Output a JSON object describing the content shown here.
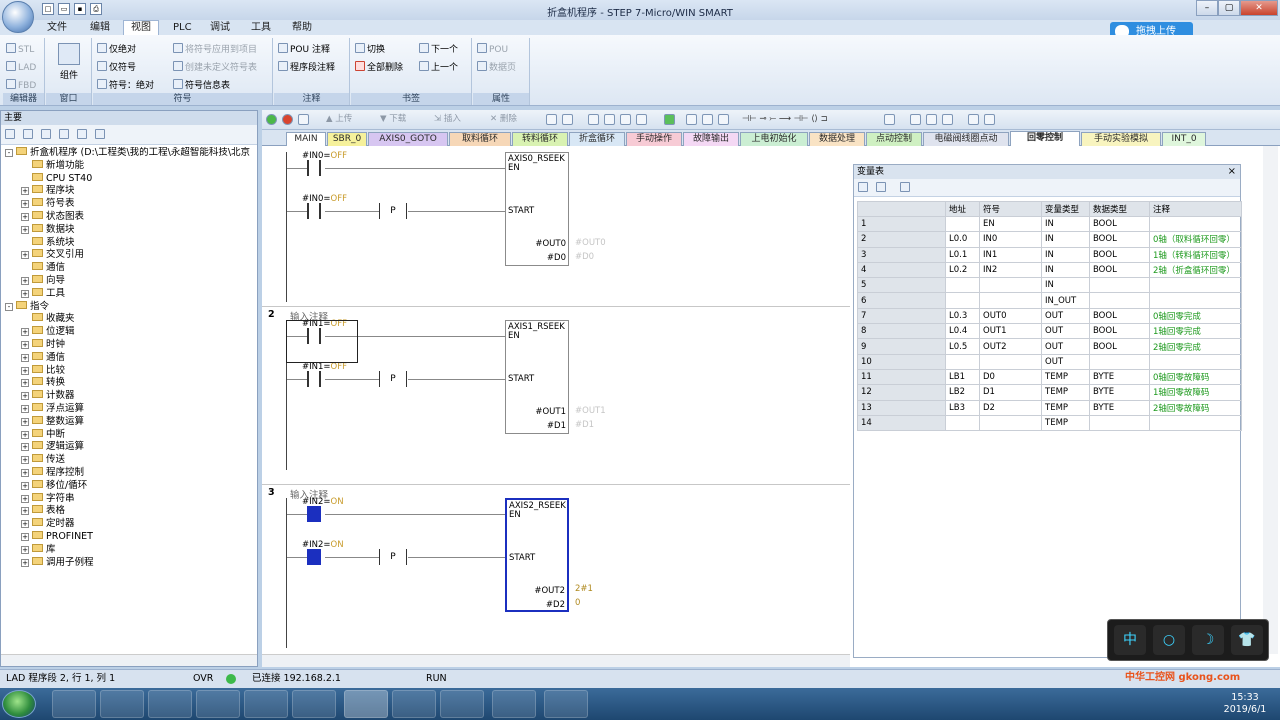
{
  "window": {
    "title": "折盒机程序 - STEP 7-Micro/WIN SMART"
  },
  "menu": [
    "文件",
    "编辑",
    "视图",
    "PLC",
    "调试",
    "工具",
    "帮助"
  ],
  "menu_active": "视图",
  "ribbon": {
    "groups": [
      {
        "label": "编辑器",
        "items": [
          "STL",
          "LAD",
          "FBD"
        ]
      },
      {
        "label": "窗口",
        "items": [
          "组件"
        ]
      },
      {
        "label": "符号",
        "items": [
          "仅绝对",
          "仅符号",
          "符号：绝对",
          "将符号应用到项目",
          "创建未定义符号表",
          "符号信息表"
        ]
      },
      {
        "label": "注释",
        "items": [
          "POU 注释",
          "程序段注释"
        ]
      },
      {
        "label": "书签",
        "items": [
          "切换",
          "全部删除",
          "下一个",
          "上一个"
        ]
      },
      {
        "label": "属性",
        "items": [
          "POU",
          "数据页"
        ]
      }
    ]
  },
  "upload_button": "拖拽上传",
  "left_panel": {
    "title": "主要",
    "tree": [
      {
        "label": "折盒机程序 (D:\\工程类\\我的工程\\永超智能科技\\北京",
        "level": 0,
        "exp": "-"
      },
      {
        "label": "新增功能",
        "level": 1,
        "exp": ""
      },
      {
        "label": "CPU ST40",
        "level": 1,
        "exp": ""
      },
      {
        "label": "程序块",
        "level": 1,
        "exp": "+"
      },
      {
        "label": "符号表",
        "level": 1,
        "exp": "+"
      },
      {
        "label": "状态图表",
        "level": 1,
        "exp": "+"
      },
      {
        "label": "数据块",
        "level": 1,
        "exp": "+"
      },
      {
        "label": "系统块",
        "level": 1,
        "exp": ""
      },
      {
        "label": "交叉引用",
        "level": 1,
        "exp": "+"
      },
      {
        "label": "通信",
        "level": 1,
        "exp": ""
      },
      {
        "label": "向导",
        "level": 1,
        "exp": "+"
      },
      {
        "label": "工具",
        "level": 1,
        "exp": "+"
      },
      {
        "label": "指令",
        "level": 0,
        "exp": "-"
      },
      {
        "label": "收藏夹",
        "level": 1,
        "exp": ""
      },
      {
        "label": "位逻辑",
        "level": 1,
        "exp": "+"
      },
      {
        "label": "时钟",
        "level": 1,
        "exp": "+"
      },
      {
        "label": "通信",
        "level": 1,
        "exp": "+"
      },
      {
        "label": "比较",
        "level": 1,
        "exp": "+"
      },
      {
        "label": "转换",
        "level": 1,
        "exp": "+"
      },
      {
        "label": "计数器",
        "level": 1,
        "exp": "+"
      },
      {
        "label": "浮点运算",
        "level": 1,
        "exp": "+"
      },
      {
        "label": "整数运算",
        "level": 1,
        "exp": "+"
      },
      {
        "label": "中断",
        "level": 1,
        "exp": "+"
      },
      {
        "label": "逻辑运算",
        "level": 1,
        "exp": "+"
      },
      {
        "label": "传送",
        "level": 1,
        "exp": "+"
      },
      {
        "label": "程序控制",
        "level": 1,
        "exp": "+"
      },
      {
        "label": "移位/循环",
        "level": 1,
        "exp": "+"
      },
      {
        "label": "字符串",
        "level": 1,
        "exp": "+"
      },
      {
        "label": "表格",
        "level": 1,
        "exp": "+"
      },
      {
        "label": "定时器",
        "level": 1,
        "exp": "+"
      },
      {
        "label": "PROFINET",
        "level": 1,
        "exp": "+"
      },
      {
        "label": "库",
        "level": 1,
        "exp": "+"
      },
      {
        "label": "调用子例程",
        "level": 1,
        "exp": "+"
      }
    ]
  },
  "toolbar": {
    "upload": "上传",
    "download": "下载",
    "insert": "插入",
    "delete": "删除"
  },
  "tabs": [
    {
      "label": "MAIN",
      "color": "#ffffff"
    },
    {
      "label": "SBR_0",
      "color": "#f6f19b"
    },
    {
      "label": "AXIS0_GOTO",
      "color": "#d7c6f1"
    },
    {
      "label": "取料循环",
      "color": "#f6d7b7"
    },
    {
      "label": "转料循环",
      "color": "#d9f2b2"
    },
    {
      "label": "折盒循环",
      "color": "#d8e7f5"
    },
    {
      "label": "手动操作",
      "color": "#f7cbd5"
    },
    {
      "label": "故障输出",
      "color": "#f4d8f4"
    },
    {
      "label": "上电初始化",
      "color": "#cbeed3"
    },
    {
      "label": "数据处理",
      "color": "#f9e3c4"
    },
    {
      "label": "点动控制",
      "color": "#cff0c2"
    },
    {
      "label": "电磁阀线圈点动",
      "color": "#dfe3ee"
    },
    {
      "label": "回零控制",
      "color": "#ffffff",
      "active": true
    },
    {
      "label": "手动实验模拟",
      "color": "#f8f4bf"
    },
    {
      "label": "INT_0",
      "color": "#dff6dc"
    }
  ],
  "networks": [
    {
      "number": "",
      "comment": "",
      "c1": "#IN0=",
      "c1s": "OFF",
      "c2": "#IN0=",
      "c2s": "OFF",
      "p": "P",
      "block": "AXIS0_RSEEK",
      "en": "EN",
      "start": "START",
      "out1": "#OUT0",
      "out1v": "#OUT0",
      "out2": "#D0",
      "out2v": "#D0",
      "on": false
    },
    {
      "number": "2",
      "comment": "输入注释",
      "c1": "#IN1=",
      "c1s": "OFF",
      "c2": "#IN1=",
      "c2s": "OFF",
      "p": "P",
      "block": "AXIS1_RSEEK",
      "en": "EN",
      "start": "START",
      "out1": "#OUT1",
      "out1v": "#OUT1",
      "out2": "#D1",
      "out2v": "#D1",
      "on": false
    },
    {
      "number": "3",
      "comment": "输入注释",
      "c1": "#IN2=",
      "c1s": "ON",
      "c2": "#IN2=",
      "c2s": "ON",
      "p": "P",
      "block": "AXIS2_RSEEK",
      "en": "EN",
      "start": "START",
      "out1": "#OUT2",
      "out1v": "2#1",
      "out2": "#D2",
      "out2v": "0",
      "on": true
    }
  ],
  "var_table": {
    "title": "变量表",
    "headers": [
      "",
      "地址",
      "符号",
      "变量类型",
      "数据类型",
      "注释"
    ],
    "rows": [
      [
        "1",
        "",
        "EN",
        "IN",
        "BOOL",
        ""
      ],
      [
        "2",
        "L0.0",
        "IN0",
        "IN",
        "BOOL",
        "0轴（取料循环回零）"
      ],
      [
        "3",
        "L0.1",
        "IN1",
        "IN",
        "BOOL",
        "1轴（转料循环回零）"
      ],
      [
        "4",
        "L0.2",
        "IN2",
        "IN",
        "BOOL",
        "2轴（折盒循环回零）"
      ],
      [
        "5",
        "",
        "",
        "IN",
        "",
        ""
      ],
      [
        "6",
        "",
        "",
        "IN_OUT",
        "",
        ""
      ],
      [
        "7",
        "L0.3",
        "OUT0",
        "OUT",
        "BOOL",
        "0轴回零完成"
      ],
      [
        "8",
        "L0.4",
        "OUT1",
        "OUT",
        "BOOL",
        "1轴回零完成"
      ],
      [
        "9",
        "L0.5",
        "OUT2",
        "OUT",
        "BOOL",
        "2轴回零完成"
      ],
      [
        "10",
        "",
        "",
        "OUT",
        "",
        ""
      ],
      [
        "11",
        "LB1",
        "D0",
        "TEMP",
        "BYTE",
        "0轴回零故障码"
      ],
      [
        "12",
        "LB2",
        "D1",
        "TEMP",
        "BYTE",
        "1轴回零故障码"
      ],
      [
        "13",
        "LB3",
        "D2",
        "TEMP",
        "BYTE",
        "2轴回零故障码"
      ],
      [
        "14",
        "",
        "",
        "TEMP",
        "",
        ""
      ]
    ]
  },
  "ime": [
    "中",
    "○",
    "☽",
    "👕"
  ],
  "status": {
    "position": "LAD 程序段 2, 行 1, 列 1",
    "mode": "OVR",
    "connection": "已连接 192.168.2.1",
    "run": "RUN"
  },
  "clock": {
    "time": "15:33",
    "date": "2019/6/1"
  },
  "watermark": "中华工控网 gkong.com"
}
